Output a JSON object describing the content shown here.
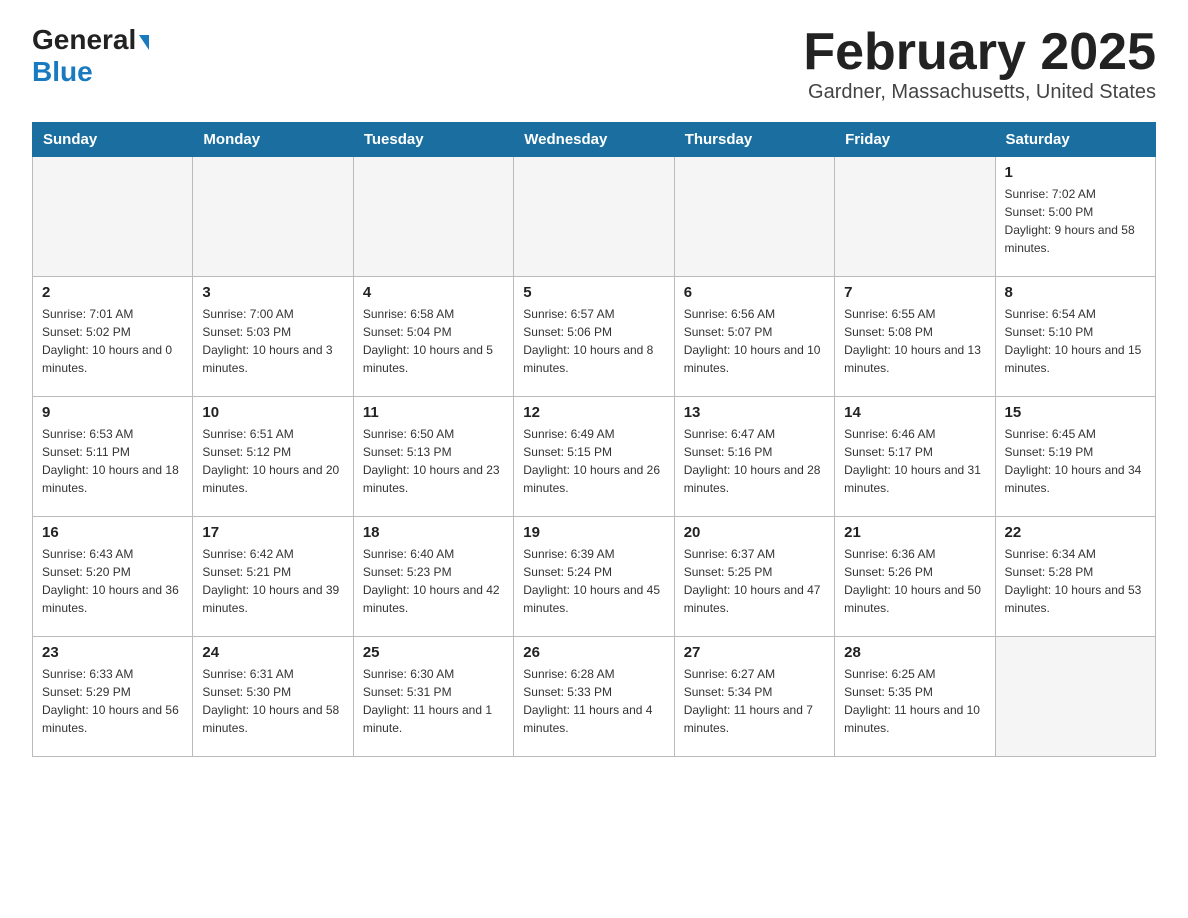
{
  "logo": {
    "general": "General",
    "blue": "Blue",
    "arrow_unicode": "▶"
  },
  "title": "February 2025",
  "subtitle": "Gardner, Massachusetts, United States",
  "days_of_week": [
    "Sunday",
    "Monday",
    "Tuesday",
    "Wednesday",
    "Thursday",
    "Friday",
    "Saturday"
  ],
  "weeks": [
    [
      {
        "day": "",
        "info": "",
        "empty": true
      },
      {
        "day": "",
        "info": "",
        "empty": true
      },
      {
        "day": "",
        "info": "",
        "empty": true
      },
      {
        "day": "",
        "info": "",
        "empty": true
      },
      {
        "day": "",
        "info": "",
        "empty": true
      },
      {
        "day": "",
        "info": "",
        "empty": true
      },
      {
        "day": "1",
        "info": "Sunrise: 7:02 AM\nSunset: 5:00 PM\nDaylight: 9 hours and 58 minutes.",
        "empty": false
      }
    ],
    [
      {
        "day": "2",
        "info": "Sunrise: 7:01 AM\nSunset: 5:02 PM\nDaylight: 10 hours and 0 minutes.",
        "empty": false
      },
      {
        "day": "3",
        "info": "Sunrise: 7:00 AM\nSunset: 5:03 PM\nDaylight: 10 hours and 3 minutes.",
        "empty": false
      },
      {
        "day": "4",
        "info": "Sunrise: 6:58 AM\nSunset: 5:04 PM\nDaylight: 10 hours and 5 minutes.",
        "empty": false
      },
      {
        "day": "5",
        "info": "Sunrise: 6:57 AM\nSunset: 5:06 PM\nDaylight: 10 hours and 8 minutes.",
        "empty": false
      },
      {
        "day": "6",
        "info": "Sunrise: 6:56 AM\nSunset: 5:07 PM\nDaylight: 10 hours and 10 minutes.",
        "empty": false
      },
      {
        "day": "7",
        "info": "Sunrise: 6:55 AM\nSunset: 5:08 PM\nDaylight: 10 hours and 13 minutes.",
        "empty": false
      },
      {
        "day": "8",
        "info": "Sunrise: 6:54 AM\nSunset: 5:10 PM\nDaylight: 10 hours and 15 minutes.",
        "empty": false
      }
    ],
    [
      {
        "day": "9",
        "info": "Sunrise: 6:53 AM\nSunset: 5:11 PM\nDaylight: 10 hours and 18 minutes.",
        "empty": false
      },
      {
        "day": "10",
        "info": "Sunrise: 6:51 AM\nSunset: 5:12 PM\nDaylight: 10 hours and 20 minutes.",
        "empty": false
      },
      {
        "day": "11",
        "info": "Sunrise: 6:50 AM\nSunset: 5:13 PM\nDaylight: 10 hours and 23 minutes.",
        "empty": false
      },
      {
        "day": "12",
        "info": "Sunrise: 6:49 AM\nSunset: 5:15 PM\nDaylight: 10 hours and 26 minutes.",
        "empty": false
      },
      {
        "day": "13",
        "info": "Sunrise: 6:47 AM\nSunset: 5:16 PM\nDaylight: 10 hours and 28 minutes.",
        "empty": false
      },
      {
        "day": "14",
        "info": "Sunrise: 6:46 AM\nSunset: 5:17 PM\nDaylight: 10 hours and 31 minutes.",
        "empty": false
      },
      {
        "day": "15",
        "info": "Sunrise: 6:45 AM\nSunset: 5:19 PM\nDaylight: 10 hours and 34 minutes.",
        "empty": false
      }
    ],
    [
      {
        "day": "16",
        "info": "Sunrise: 6:43 AM\nSunset: 5:20 PM\nDaylight: 10 hours and 36 minutes.",
        "empty": false
      },
      {
        "day": "17",
        "info": "Sunrise: 6:42 AM\nSunset: 5:21 PM\nDaylight: 10 hours and 39 minutes.",
        "empty": false
      },
      {
        "day": "18",
        "info": "Sunrise: 6:40 AM\nSunset: 5:23 PM\nDaylight: 10 hours and 42 minutes.",
        "empty": false
      },
      {
        "day": "19",
        "info": "Sunrise: 6:39 AM\nSunset: 5:24 PM\nDaylight: 10 hours and 45 minutes.",
        "empty": false
      },
      {
        "day": "20",
        "info": "Sunrise: 6:37 AM\nSunset: 5:25 PM\nDaylight: 10 hours and 47 minutes.",
        "empty": false
      },
      {
        "day": "21",
        "info": "Sunrise: 6:36 AM\nSunset: 5:26 PM\nDaylight: 10 hours and 50 minutes.",
        "empty": false
      },
      {
        "day": "22",
        "info": "Sunrise: 6:34 AM\nSunset: 5:28 PM\nDaylight: 10 hours and 53 minutes.",
        "empty": false
      }
    ],
    [
      {
        "day": "23",
        "info": "Sunrise: 6:33 AM\nSunset: 5:29 PM\nDaylight: 10 hours and 56 minutes.",
        "empty": false
      },
      {
        "day": "24",
        "info": "Sunrise: 6:31 AM\nSunset: 5:30 PM\nDaylight: 10 hours and 58 minutes.",
        "empty": false
      },
      {
        "day": "25",
        "info": "Sunrise: 6:30 AM\nSunset: 5:31 PM\nDaylight: 11 hours and 1 minute.",
        "empty": false
      },
      {
        "day": "26",
        "info": "Sunrise: 6:28 AM\nSunset: 5:33 PM\nDaylight: 11 hours and 4 minutes.",
        "empty": false
      },
      {
        "day": "27",
        "info": "Sunrise: 6:27 AM\nSunset: 5:34 PM\nDaylight: 11 hours and 7 minutes.",
        "empty": false
      },
      {
        "day": "28",
        "info": "Sunrise: 6:25 AM\nSunset: 5:35 PM\nDaylight: 11 hours and 10 minutes.",
        "empty": false
      },
      {
        "day": "",
        "info": "",
        "empty": true
      }
    ]
  ]
}
